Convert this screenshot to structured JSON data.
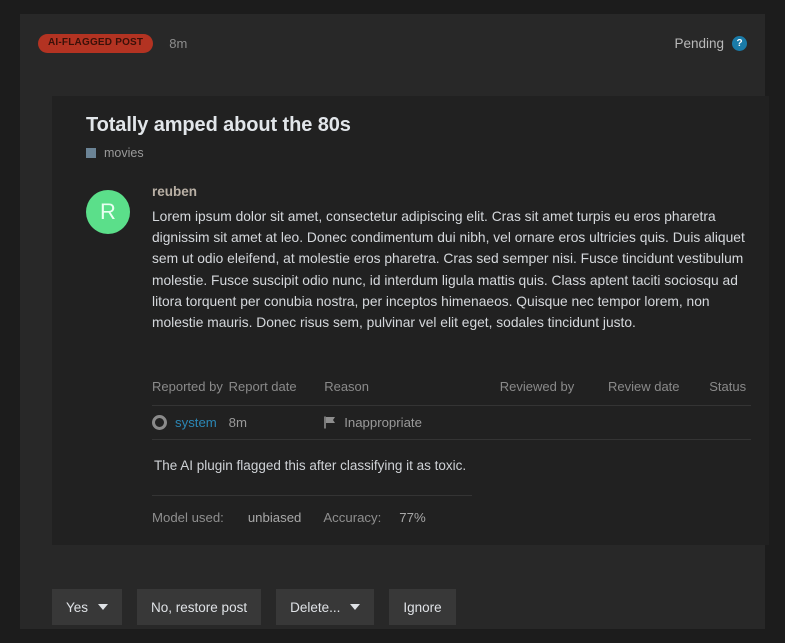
{
  "header": {
    "badge": "AI-FLAGGED POST",
    "age": "8m",
    "status": "Pending",
    "help_icon": "?",
    "badge_color": "#b33322",
    "help_color": "#1a7ba8"
  },
  "post": {
    "title": "Totally amped about the 80s",
    "category": "movies",
    "category_color": "#6b8496",
    "author": "reuben",
    "avatar_letter": "R",
    "avatar_color": "#5bdf8a",
    "text": "Lorem ipsum dolor sit amet, consectetur adipiscing elit. Cras sit amet turpis eu eros pharetra dignissim sit amet at leo. Donec condimentum dui nibh, vel ornare eros ultricies quis. Duis aliquet sem ut odio eleifend, at molestie eros pharetra. Cras sed semper nisi. Fusce tincidunt vestibulum molestie. Fusce suscipit odio nunc, id interdum ligula mattis quis. Class aptent taciti sociosqu ad litora torquent per conubia nostra, per inceptos himenaeos. Quisque nec tempor lorem, non molestie mauris. Donec risus sem, pulvinar vel elit eget, sodales tincidunt justo."
  },
  "report_table": {
    "headers": {
      "reported_by": "Reported by",
      "report_date": "Report date",
      "reason": "Reason",
      "reviewed_by": "Reviewed by",
      "review_date": "Review date",
      "status": "Status"
    },
    "row": {
      "reported_by": "system",
      "report_date": "8m",
      "reason": "Inappropriate",
      "reviewed_by": "",
      "review_date": "",
      "status": "",
      "link_color": "#2b87b5"
    }
  },
  "flag_note": "The AI plugin flagged this after classifying it as toxic.",
  "model_info": {
    "model_key": "Model used:",
    "model_value": "unbiased",
    "accuracy_key": "Accuracy:",
    "accuracy_value": "77%"
  },
  "actions": {
    "yes": "Yes",
    "restore": "No, restore post",
    "delete": "Delete...",
    "ignore": "Ignore"
  }
}
